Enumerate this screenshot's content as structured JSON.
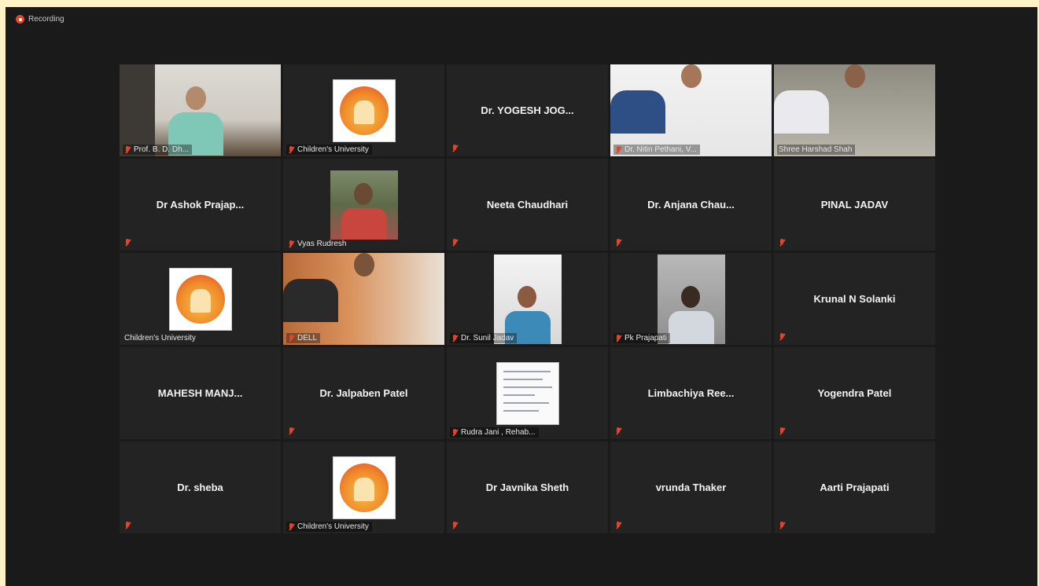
{
  "recording": {
    "label": "Recording"
  },
  "colors": {
    "active_speaker": "#b7dd3c",
    "muted": "#e0462c",
    "background": "#1a1a1a"
  },
  "tiles": [
    {
      "name": "Prof. B. D. Dh...",
      "kind": "video",
      "muted": true
    },
    {
      "name": "Children's University",
      "kind": "logo",
      "muted": true
    },
    {
      "name": "Dr. YOGESH JOG...",
      "kind": "name",
      "muted": true
    },
    {
      "name": "Dr. Nitin Pethani, V...",
      "kind": "video",
      "muted": true
    },
    {
      "name": "Shree Harshad Shah",
      "kind": "video",
      "muted": false,
      "active": true
    },
    {
      "name": "Dr Ashok Prajap...",
      "kind": "name",
      "muted": true
    },
    {
      "name": "Vyas Rudresh",
      "kind": "photo",
      "muted": true
    },
    {
      "name": "Neeta Chaudhari",
      "kind": "name",
      "muted": true
    },
    {
      "name": "Dr. Anjana Chau...",
      "kind": "name",
      "muted": true
    },
    {
      "name": "PINAL JADAV",
      "kind": "name",
      "muted": true
    },
    {
      "name": "Children's University",
      "kind": "logo",
      "muted": false
    },
    {
      "name": "DELL",
      "kind": "video",
      "muted": true
    },
    {
      "name": "Dr. Sunil Jadav",
      "kind": "photo",
      "muted": true
    },
    {
      "name": "Pk Prajapati",
      "kind": "photo",
      "muted": true
    },
    {
      "name": "Krunal N Solanki",
      "kind": "name",
      "muted": true
    },
    {
      "name": "MAHESH  MANJ...",
      "kind": "name",
      "muted": true
    },
    {
      "name": "Dr. Jalpaben Patel",
      "kind": "name",
      "muted": true
    },
    {
      "name": "Rudra Jani , Rehab...",
      "kind": "photo",
      "muted": true
    },
    {
      "name": "Limbachiya  Ree...",
      "kind": "name",
      "muted": true
    },
    {
      "name": "Yogendra Patel",
      "kind": "name",
      "muted": true
    },
    {
      "name": "Dr. sheba",
      "kind": "name",
      "muted": true
    },
    {
      "name": "Children's University",
      "kind": "logo",
      "muted": true
    },
    {
      "name": "Dr Javnika Sheth",
      "kind": "name",
      "muted": true
    },
    {
      "name": "vrunda Thaker",
      "kind": "name",
      "muted": true
    },
    {
      "name": "Aarti Prajapati",
      "kind": "name",
      "muted": true
    }
  ]
}
